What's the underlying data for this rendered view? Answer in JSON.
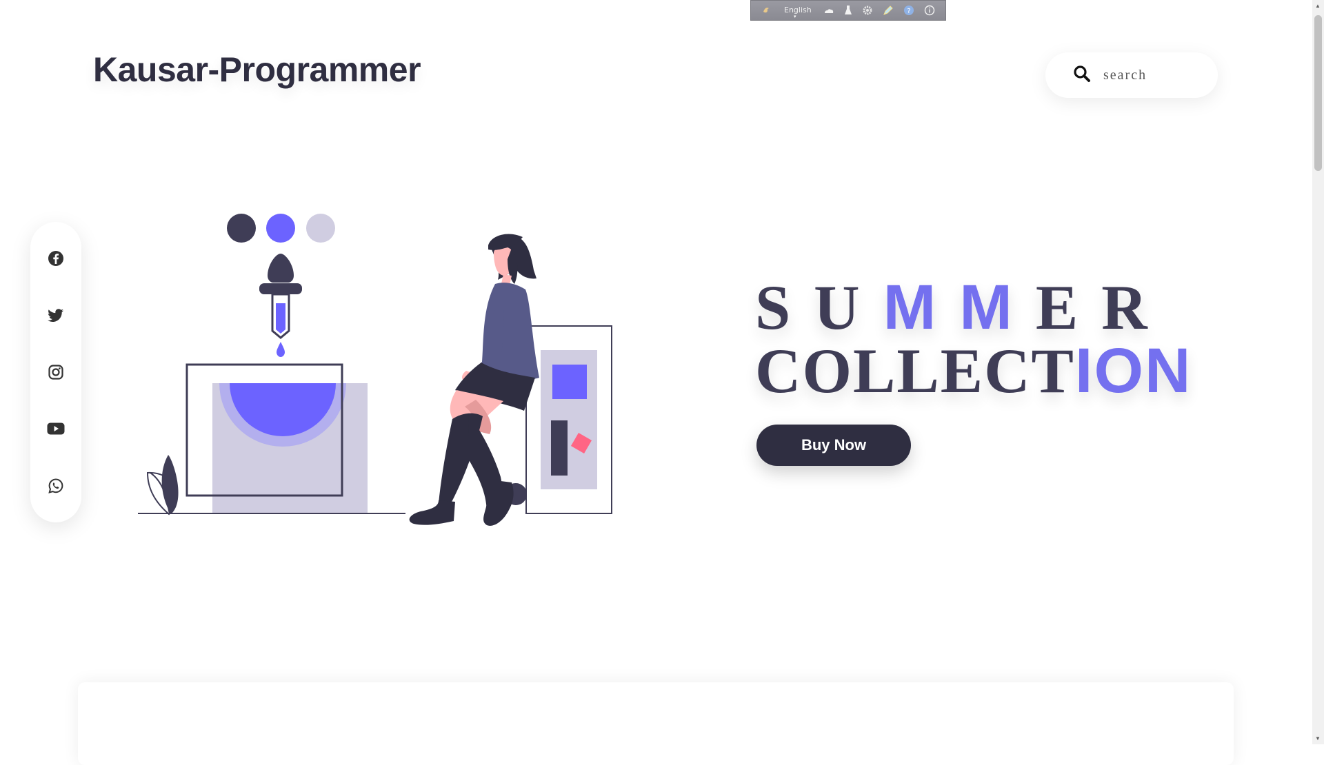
{
  "toolbar": {
    "language_label": "English",
    "icons": [
      "logo-icon",
      "cloud-icon",
      "flask-icon",
      "gear-icon",
      "pen-icon",
      "help-icon",
      "info-icon"
    ]
  },
  "header": {
    "logo_text": "Kausar-Programmer",
    "search_placeholder": "search"
  },
  "social": {
    "items": [
      "facebook-icon",
      "twitter-icon",
      "instagram-icon",
      "youtube-icon",
      "whatsapp-icon"
    ]
  },
  "hero": {
    "line1_dark_a": "SU",
    "line1_accent": "MM",
    "line1_dark_b": "ER",
    "line2_dark": "COLLECT",
    "line2_accent": "ION",
    "button_label": "Buy Now"
  },
  "colors": {
    "primary_dark": "#2f2e41",
    "text_dark": "#3f3d56",
    "accent": "#6c63ff",
    "accent_text": "#7470ef",
    "light_purple": "#d0cde1",
    "pink": "#ff6584",
    "skin": "#ffb8b8"
  }
}
